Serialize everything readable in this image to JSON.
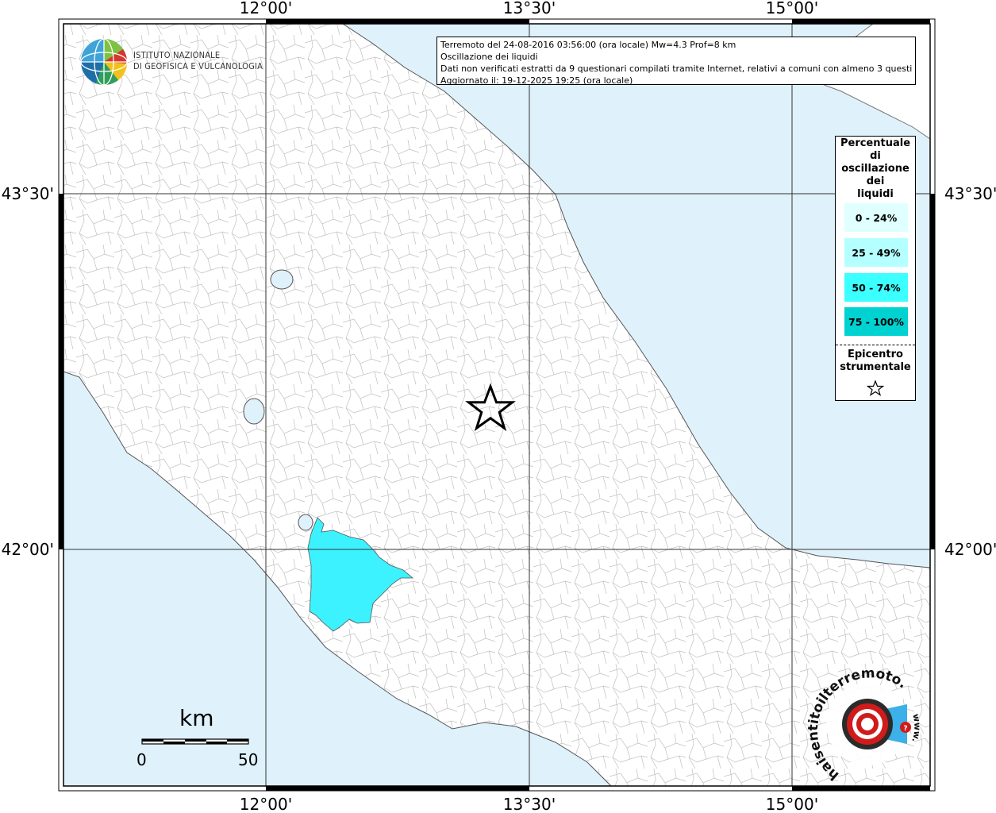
{
  "header": {
    "line1": "Terremoto del 24-08-2016 03:56:00 (ora locale) Mw=4.3 Prof=8 km",
    "line2": "Oscillazione dei liquidi",
    "line3": "Dati non verificati estratti da 9 questionari compilati tramite Internet, relativi a comuni con almeno 3 questionari.",
    "line4": "Aggiornato il: 19-12-2025 19:25 (ora locale)"
  },
  "logo": {
    "line1": "ISTITUTO NAZIONALE",
    "line2": "DI GEOFISICA E VULCANOLOGIA",
    "icon": "ingv-globe-logo"
  },
  "axes": {
    "top": [
      "12°00'",
      "13°30'",
      "15°00'"
    ],
    "bottom": [
      "12°00'",
      "13°30'",
      "15°00'"
    ],
    "left": [
      "43°30'",
      "42°00'"
    ],
    "right": [
      "43°30'",
      "42°00'"
    ]
  },
  "legend": {
    "title_lines": [
      "Percentuale",
      "di",
      "oscillazione",
      "dei",
      "liquidi"
    ],
    "classes": [
      {
        "label": "0 - 24%",
        "color": "#e0ffff"
      },
      {
        "label": "25 - 49%",
        "color": "#b4ffff"
      },
      {
        "label": "50 - 74%",
        "color": "#3cffff"
      },
      {
        "label": "75 - 100%",
        "color": "#00d2d2"
      }
    ],
    "epicenter_lines": [
      "Epicentro",
      "strumentale"
    ],
    "epicenter_icon": "star-outline-icon"
  },
  "scale": {
    "unit": "km",
    "min": "0",
    "max": "50"
  },
  "badge": {
    "text": "haisentitoilterremoto.it",
    "url_text": "www.",
    "icon": "seismic-target-logo"
  },
  "colors": {
    "sea": "#dff1fb",
    "land": "#ffffff",
    "highlight": "#3cf2ff"
  }
}
